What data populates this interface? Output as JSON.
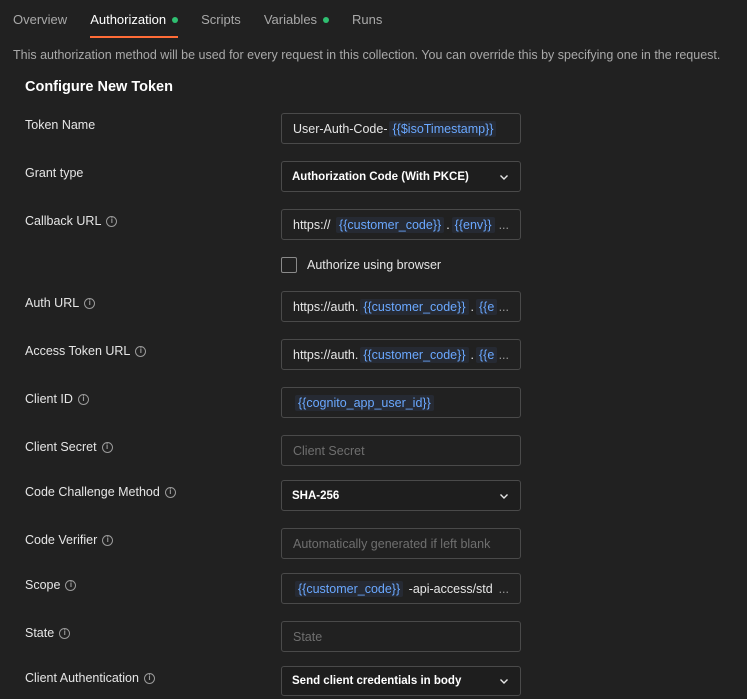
{
  "tabs": [
    {
      "label": "Overview",
      "active": false,
      "dot": false
    },
    {
      "label": "Authorization",
      "active": true,
      "dot": true
    },
    {
      "label": "Scripts",
      "active": false,
      "dot": false
    },
    {
      "label": "Variables",
      "active": false,
      "dot": true
    },
    {
      "label": "Runs",
      "active": false,
      "dot": false
    }
  ],
  "colors": {
    "accent": "#ff6c37",
    "status_dot": "#2fbf71",
    "variable": "#6aa8ff"
  },
  "info_text": "This authorization method will be used for every request in this collection. You can override this by specifying one in the request.",
  "section_title": "Configure New Token",
  "fields": {
    "token_name": {
      "label": "Token Name",
      "prefix": "User-Auth-Code-",
      "var": "{{$isoTimestamp}}"
    },
    "grant_type": {
      "label": "Grant type",
      "value": "Authorization Code (With PKCE)"
    },
    "callback_url": {
      "label": "Callback URL",
      "prefix": "https://",
      "var1": "{{customer_code}}",
      "sep": ".",
      "var2": "{{env}}",
      "suffix": ".",
      "ellipsis": "..."
    },
    "authorize_browser": {
      "label": "Authorize using browser",
      "checked": false
    },
    "auth_url": {
      "label": "Auth URL",
      "prefix": "https://auth.",
      "var1": "{{customer_code}}",
      "sep": ".",
      "var2": "{{e",
      "ellipsis": "..."
    },
    "access_token_url": {
      "label": "Access Token URL",
      "prefix": "https://auth.",
      "var1": "{{customer_code}}",
      "sep": ".",
      "var2": "{{e",
      "ellipsis": "..."
    },
    "client_id": {
      "label": "Client ID",
      "var": "{{cognito_app_user_id}}"
    },
    "client_secret": {
      "label": "Client Secret",
      "placeholder": "Client Secret"
    },
    "code_challenge_method": {
      "label": "Code Challenge Method",
      "value": "SHA-256"
    },
    "code_verifier": {
      "label": "Code Verifier",
      "placeholder": "Automatically generated if left blank"
    },
    "scope": {
      "label": "Scope",
      "var": "{{customer_code}}",
      "suffix": "-api-access/std",
      "ellipsis": "..."
    },
    "state": {
      "label": "State",
      "placeholder": "State"
    },
    "client_auth": {
      "label": "Client Authentication",
      "value": "Send client credentials in body"
    }
  },
  "icons": {
    "info": "info-icon",
    "chevron": "chevron-down-icon"
  }
}
